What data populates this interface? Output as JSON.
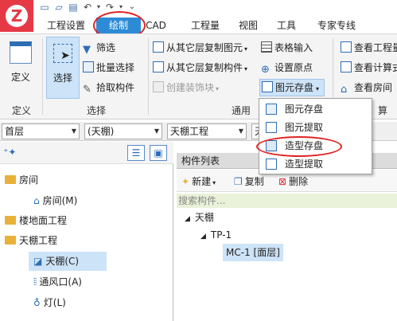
{
  "quick_access": {
    "icons": [
      "new-file-icon",
      "open-folder-icon",
      "save-icon",
      "undo-icon",
      "dropdown-arrow-icon",
      "redo-icon",
      "dropdown-arrow-icon",
      "customize-icon"
    ]
  },
  "tabs": [
    {
      "label": "工程设置",
      "active": false
    },
    {
      "label": "绘制",
      "active": true
    },
    {
      "label": "CAD",
      "active": false
    },
    {
      "label": "工程量",
      "active": false
    },
    {
      "label": "视图",
      "active": false
    },
    {
      "label": "工具",
      "active": false
    },
    {
      "label": "专家专线",
      "active": false
    }
  ],
  "ribbon": {
    "define": {
      "button": "定义",
      "group": "定义"
    },
    "select": {
      "button": "选择",
      "filter": "筛选",
      "batch": "批量选择",
      "pick": "拾取构件",
      "group": "选择"
    },
    "common": {
      "copy_elements": "从其它层复制图元",
      "copy_components": "从其它层复制构件",
      "create_decor": "创建装饰块",
      "table_input": "表格输入",
      "set_origin": "设置原点",
      "save_element": "图元存盘",
      "group": "通用"
    },
    "right": {
      "view_qty": "查看工程量",
      "view_calc": "查看计算式",
      "view_room": "查看房间",
      "group": "算"
    }
  },
  "dropdown_menu": {
    "items": [
      "图元存盘",
      "图元提取",
      "造型存盘",
      "造型提取"
    ],
    "highlighted_index": 2
  },
  "combos": {
    "floor": "首层",
    "type": "(天棚)",
    "component_type": "天棚工程",
    "extra": "天"
  },
  "left_tree": {
    "items": [
      {
        "label": "房间",
        "level": 0,
        "icon": "folder-icon"
      },
      {
        "label": "房间(M)",
        "level": 1,
        "icon": "house-icon"
      },
      {
        "label": "楼地面工程",
        "level": 0,
        "icon": "folder-icon"
      },
      {
        "label": "天棚工程",
        "level": 0,
        "icon": "folder-icon"
      },
      {
        "label": "天棚(C)",
        "level": 1,
        "icon": "ceiling-icon",
        "selected": true
      },
      {
        "label": "通风口(A)",
        "level": 1,
        "icon": "vent-icon"
      },
      {
        "label": "灯(L)",
        "level": 1,
        "icon": "bulb-icon"
      }
    ]
  },
  "component_list": {
    "title": "构件列表",
    "new_label": "新建",
    "copy_label": "复制",
    "delete_label": "删除",
    "search_placeholder": "搜索构件...",
    "nodes": [
      {
        "label": "天棚",
        "level": 0
      },
      {
        "label": "TP-1",
        "level": 1
      },
      {
        "label": "MC-1 [面层]",
        "level": 2,
        "selected": true
      }
    ]
  }
}
